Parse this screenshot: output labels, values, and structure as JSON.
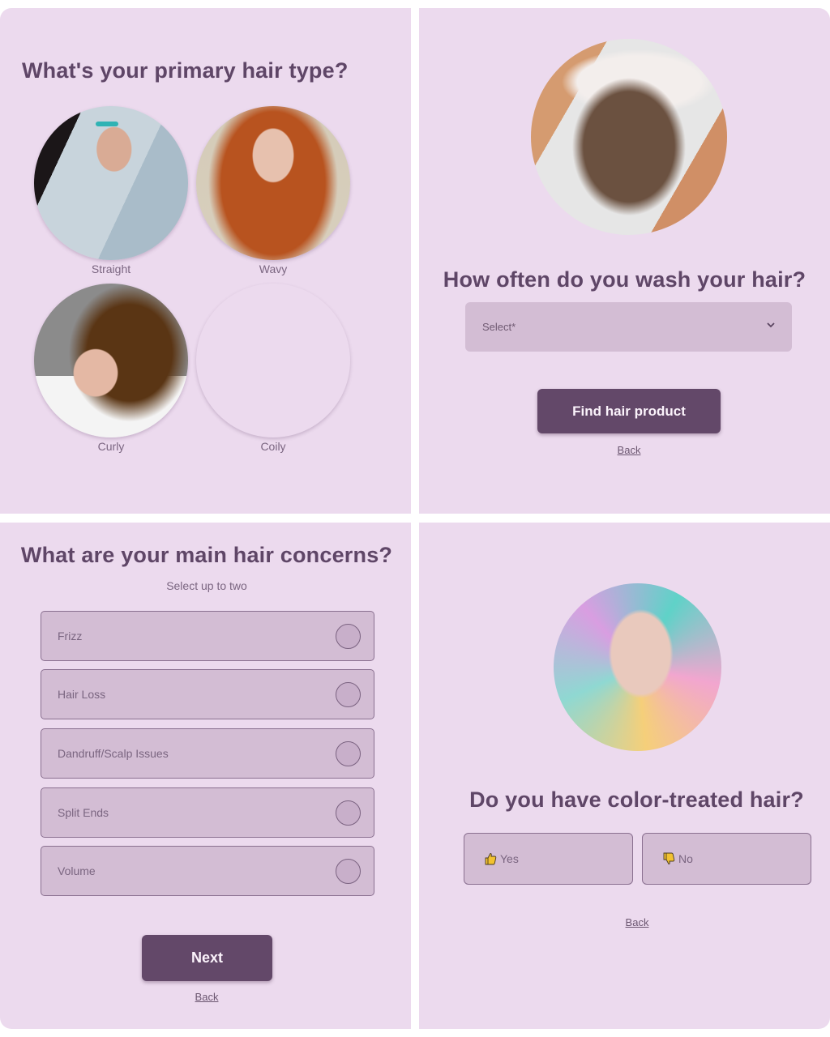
{
  "hair_type": {
    "title": "What's your primary hair type?",
    "options": [
      {
        "label": "Straight"
      },
      {
        "label": "Wavy"
      },
      {
        "label": "Curly"
      },
      {
        "label": "Coily"
      }
    ]
  },
  "wash_frequency": {
    "title": "How often do you wash your hair?",
    "select_placeholder": "Select*",
    "submit_label": "Find hair product",
    "back_label": "Back"
  },
  "concerns": {
    "title": "What are your main hair concerns?",
    "subtitle": "Select up to two",
    "options": [
      {
        "label": "Frizz",
        "selected": false
      },
      {
        "label": "Hair Loss",
        "selected": false
      },
      {
        "label": "Dandruff/Scalp Issues",
        "selected": false
      },
      {
        "label": "Split Ends",
        "selected": false
      },
      {
        "label": "Volume",
        "selected": false
      }
    ],
    "next_label": "Next",
    "back_label": "Back"
  },
  "color_treated": {
    "title": "Do you have color-treated hair?",
    "yes_label": "Yes",
    "no_label": "No",
    "yes_icon": "thumbs-up-icon",
    "no_icon": "thumbs-down-icon",
    "back_label": "Back"
  },
  "colors": {
    "background": "#ecdaee",
    "field": "#d3bdd4",
    "primary": "#634869",
    "heading": "#5f4667"
  }
}
